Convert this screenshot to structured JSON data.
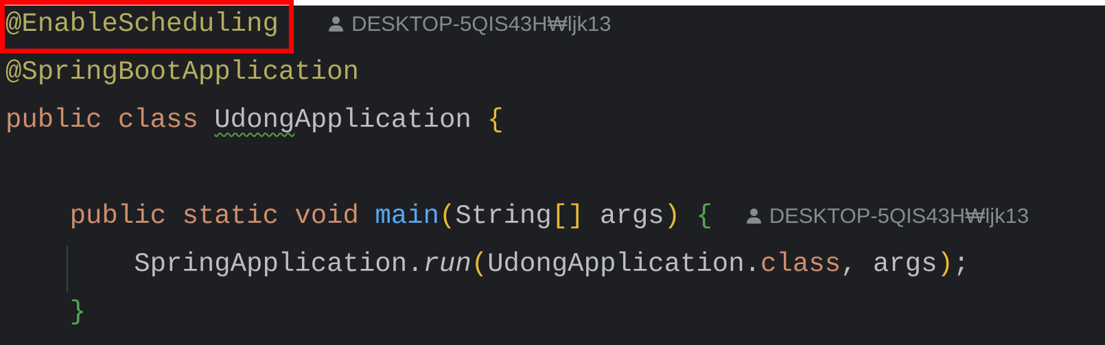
{
  "code": {
    "line1": {
      "annotation": "@EnableScheduling",
      "author": "DESKTOP-5QIS43H₩ljk13"
    },
    "line2": {
      "annotation": "@SpringBootApplication"
    },
    "line3": {
      "kw1": "public",
      "kw2": "class",
      "class_underlined": "Udong",
      "class_rest": "Application",
      "brace": "{"
    },
    "line5": {
      "kw1": "public",
      "kw2": "static",
      "kw3": "void",
      "method": "main",
      "open": "(",
      "type": "String",
      "brackets": "[]",
      "param": "args",
      "close": ")",
      "brace": "{",
      "author": "DESKTOP-5QIS43H₩ljk13"
    },
    "line6": {
      "receiver": "SpringApplication.",
      "call": "run",
      "open": "(",
      "arg1": "UdongApplication.",
      "kw": "class",
      "rest": ", args",
      "close": ")",
      "semi": ";"
    },
    "line7": {
      "brace": "}"
    }
  },
  "colors": {
    "background": "#1e1f22",
    "annotation": "#b3ae60",
    "keyword": "#cf8e6d",
    "method": "#56a8f5",
    "highlight_box": "#ff0000"
  }
}
